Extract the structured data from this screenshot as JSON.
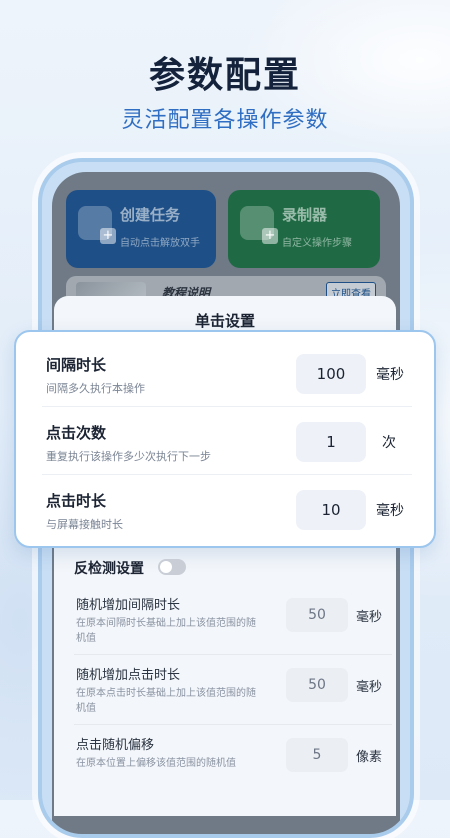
{
  "hero": {
    "title": "参数配置",
    "subtitle": "灵活配置各操作参数"
  },
  "app": {
    "tiles": [
      {
        "title": "创建任务",
        "subtitle": "自动点击解放双手",
        "icon": "hand-tap-icon"
      },
      {
        "title": "录制器",
        "subtitle": "自定义操作步骤",
        "icon": "record-icon"
      }
    ],
    "tutorial": {
      "title": "教程说明",
      "button": "立即查看"
    }
  },
  "sheet": {
    "title": "单击设置"
  },
  "highlight_rows": [
    {
      "label": "间隔时长",
      "desc": "间隔多久执行本操作",
      "value": "100",
      "unit": "毫秒"
    },
    {
      "label": "点击次数",
      "desc": "重复执行该操作多少次执行下一步",
      "value": "1",
      "unit": "次"
    },
    {
      "label": "点击时长",
      "desc": "与屏幕接触时长",
      "value": "10",
      "unit": "毫秒"
    }
  ],
  "anti_detect": {
    "label": "反检测设置",
    "enabled": false,
    "rows": [
      {
        "label": "随机增加间隔时长",
        "desc": "在原本间隔时长基础上加上该值范围的随机值",
        "value": "50",
        "unit": "毫秒"
      },
      {
        "label": "随机增加点击时长",
        "desc": "在原本点击时长基础上加上该值范围的随机值",
        "value": "50",
        "unit": "毫秒"
      },
      {
        "label": "点击随机偏移",
        "desc": "在原本位置上偏移该值范围的随机值",
        "value": "5",
        "unit": "像素"
      }
    ]
  }
}
